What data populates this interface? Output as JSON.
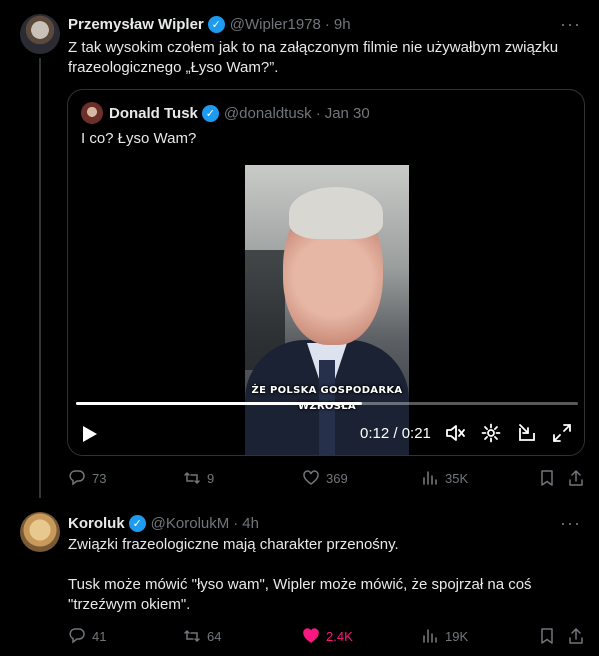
{
  "tweet1": {
    "name": "Przemysław Wipler",
    "handle": "@Wipler1978",
    "separator": "·",
    "time": "9h",
    "text": "Z tak wysokim czołem jak to na załączonym filmie nie używałbym związku\nfrazeologicznego „Łyso Wam?”.",
    "quote": {
      "name": "Donald Tusk",
      "handle": "@donaldtusk",
      "separator": "·",
      "time": "Jan 30",
      "text": "I co? Łyso Wam?",
      "video": {
        "caption_line1": "ŻE POLSKA GOSPODARKA",
        "caption_line2": "WZROSŁA",
        "time_display": "0:12 / 0:21",
        "progress": 0.57
      }
    },
    "actions": {
      "replies": "73",
      "reposts": "9",
      "likes": "369",
      "views": "35K"
    }
  },
  "tweet2": {
    "name": "Koroluk",
    "handle": "@KorolukM",
    "separator": "·",
    "time": "4h",
    "text": "Związki frazeologiczne mają charakter przenośny.\n\nTusk może mówić \"łyso wam\", Wipler może mówić, że spojrzał na coś\n\"trzeźwym okiem\".",
    "actions": {
      "replies": "41",
      "reposts": "64",
      "likes": "2.4K",
      "likes_active": true,
      "views": "19K"
    }
  },
  "colors": {
    "background": "#000000",
    "text": "#e7e9ea",
    "muted": "#71767b",
    "verified": "#1d9bf0",
    "like_active": "#f91880",
    "border": "#2f3336"
  },
  "icons": [
    "more-icon",
    "verified-icon",
    "play-icon",
    "mute-icon",
    "settings-icon",
    "pip-icon",
    "fullscreen-icon",
    "reply-icon",
    "repost-icon",
    "like-icon",
    "views-icon",
    "bookmark-icon",
    "share-icon"
  ]
}
